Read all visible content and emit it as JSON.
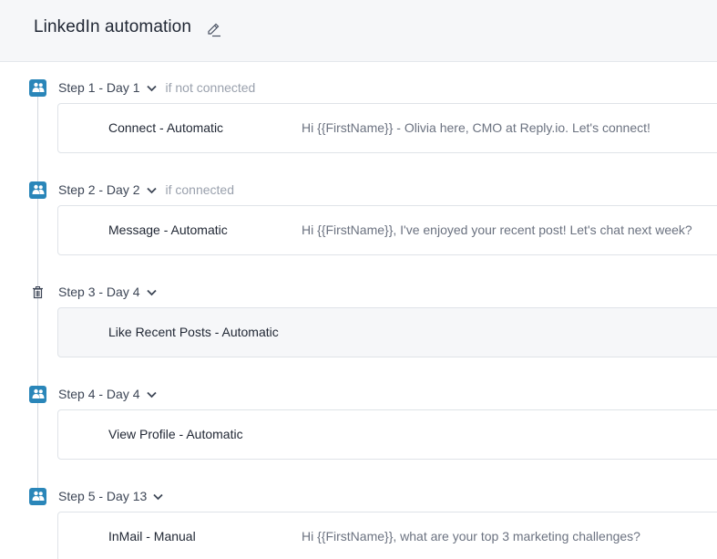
{
  "header": {
    "title": "LinkedIn automation",
    "edit_icon": "pencil-icon"
  },
  "colors": {
    "accent": "#2a86b9",
    "header_bg": "#f6f7f9",
    "muted_text": "#9aa1ad"
  },
  "steps": [
    {
      "label": "Step 1 - Day 1",
      "condition": "if not connected",
      "icon": "linkedin-people-icon",
      "action": "Connect - Automatic",
      "message": "Hi {{FirstName}} - Olivia here, CMO at Reply.io. Let's connect!"
    },
    {
      "label": "Step 2 - Day 2",
      "condition": "if connected",
      "icon": "linkedin-people-icon",
      "action": "Message - Automatic",
      "message": "Hi {{FirstName}}, I've enjoyed your recent post! Let's chat next week?"
    },
    {
      "label": "Step 3 - Day 4",
      "condition": "",
      "icon": "trash-icon",
      "action": "Like Recent Posts - Automatic",
      "message": ""
    },
    {
      "label": "Step 4 - Day 4",
      "condition": "",
      "icon": "linkedin-people-icon",
      "action": "View Profile - Automatic",
      "message": ""
    },
    {
      "label": "Step 5 - Day 13",
      "condition": "",
      "icon": "linkedin-people-icon",
      "action": "InMail - Manual",
      "message": "Hi {{FirstName}}, what are your top 3 marketing challenges?"
    }
  ]
}
